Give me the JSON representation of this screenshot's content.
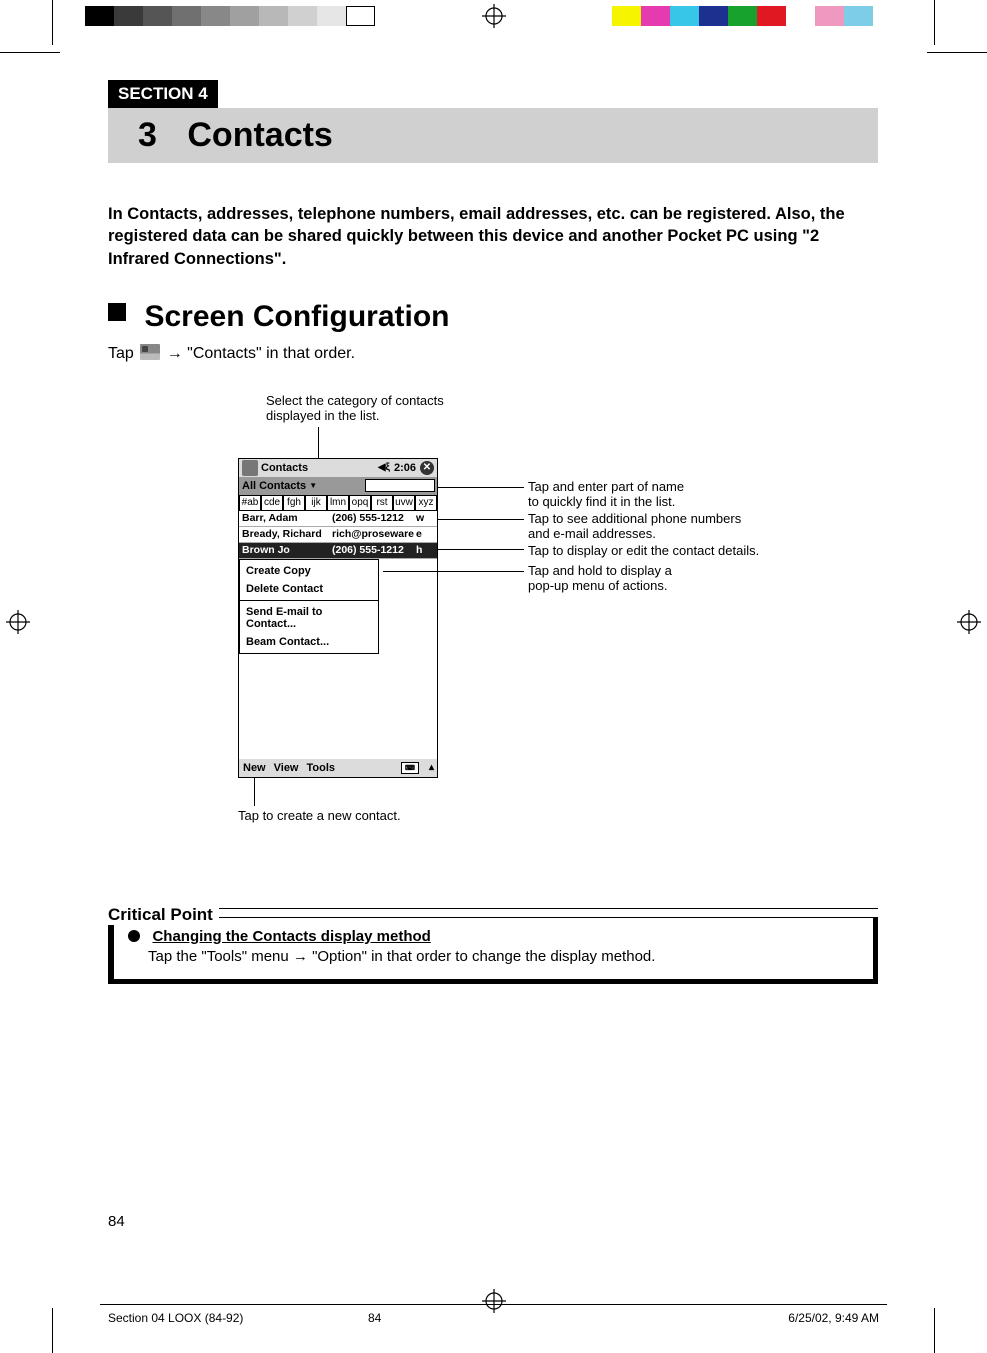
{
  "colorbar_left": [
    "#000000",
    "#3a3a3a",
    "#555555",
    "#707070",
    "#888888",
    "#a0a0a0",
    "#b8b8b8",
    "#d0d0d0",
    "#e6e6e6",
    "#ffffff"
  ],
  "colorbar_right": [
    "#f7f400",
    "#e63ab0",
    "#37c6e8",
    "#1d2f8f",
    "#16a22c",
    "#e01822",
    "#ffffff",
    "#ef98c0",
    "#7ecde8",
    "#ffffff"
  ],
  "section_label": "SECTION 4",
  "chapter_number": "3",
  "chapter_title": "Contacts",
  "intro": "In Contacts, addresses, telephone numbers, email addresses, etc. can be registered. Also, the registered data can be shared quickly between this device and another Pocket PC using \"2 Infrared Connections\".",
  "screen_config": {
    "heading": "Screen Configuration",
    "tap_pre": "Tap ",
    "tap_post": " → \"Contacts\" in that order."
  },
  "annotations": {
    "top": "Select the category of contacts displayed in the list.",
    "right1a": "Tap and enter part of name",
    "right1b": "to quickly find it in the list.",
    "right2a": "Tap to see additional phone numbers",
    "right2b": "and e-mail addresses.",
    "right3": "Tap to display or edit the contact details.",
    "right4a": "Tap and hold to display a",
    "right4b": "pop-up menu of actions.",
    "bottom": "Tap to create a new contact."
  },
  "device": {
    "title": "Contacts",
    "time": "2:06",
    "filter": "All Contacts",
    "alpha": [
      "#ab",
      "cde",
      "fgh",
      "ijk",
      "lmn",
      "opq",
      "rst",
      "uvw",
      "xyz"
    ],
    "rows": [
      {
        "name": "Barr, Adam",
        "phone": "(206) 555-1212",
        "type": "w"
      },
      {
        "name": "Bready, Richard",
        "phone": "rich@proseware....",
        "type": "e"
      },
      {
        "name": "Brown  Jo",
        "phone": "(206) 555-1212",
        "type": "h"
      }
    ],
    "popup": [
      "Create Copy",
      "Delete Contact",
      "Send E-mail to Contact...",
      "Beam Contact..."
    ],
    "menu": [
      "New",
      "View",
      "Tools"
    ]
  },
  "critical": {
    "label": "Critical Point",
    "title": "Changing the Contacts display method",
    "body": "Tap the \"Tools\" menu → \"Option\" in that order to change the display method."
  },
  "page_number": "84",
  "footer": {
    "slug": "Section 04 LOOX (84-92)",
    "page": "84",
    "datetime": "6/25/02, 9:49 AM"
  }
}
